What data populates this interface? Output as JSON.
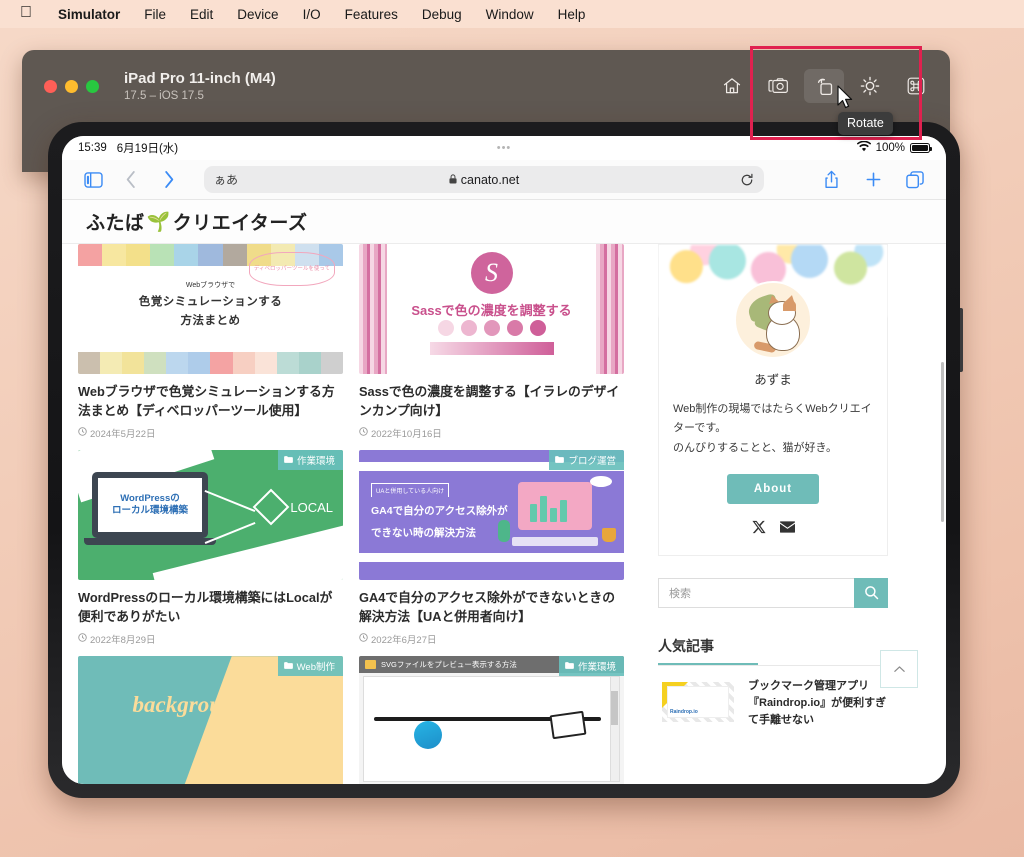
{
  "menubar": {
    "apple_icon": "apple-logo-icon",
    "items": [
      {
        "label": "Simulator",
        "bold": true
      },
      {
        "label": "File",
        "bold": false
      },
      {
        "label": "Edit",
        "bold": false
      },
      {
        "label": "Device",
        "bold": false
      },
      {
        "label": "I/O",
        "bold": false
      },
      {
        "label": "Features",
        "bold": false
      },
      {
        "label": "Debug",
        "bold": false
      },
      {
        "label": "Window",
        "bold": false
      },
      {
        "label": "Help",
        "bold": false
      }
    ]
  },
  "simulator_window": {
    "title": "iPad Pro 11-inch (M4)",
    "subtitle": "17.5 – iOS 17.5",
    "traffic_lights": [
      "close",
      "minimize",
      "zoom"
    ],
    "toolbar": [
      {
        "name": "home-icon",
        "label": "Home"
      },
      {
        "name": "screenshot-icon",
        "label": "Screenshot"
      },
      {
        "name": "rotate-icon",
        "label": "Rotate"
      },
      {
        "name": "brightness-icon",
        "label": "Appearance"
      },
      {
        "name": "command-icon",
        "label": "More"
      }
    ],
    "tooltip": "Rotate",
    "highlight_color": "#e0214f"
  },
  "ipad": {
    "statusbar": {
      "time": "15:39",
      "date": "6月19日(水)",
      "dots": "•••",
      "wifi": "wifi-icon",
      "battery_percent": "100%"
    },
    "safari": {
      "sidebar_icon": "sidebar-icon",
      "back_icon": "chevron-left-icon",
      "forward_icon": "chevron-right-icon",
      "text_size_label": "ぁあ",
      "lock_icon": "lock-icon",
      "url": "canato.net",
      "reload_icon": "reload-icon",
      "share_icon": "share-icon",
      "new_tab_icon": "plus-icon",
      "tabs_icon": "tabs-icon"
    },
    "site": {
      "logo_text_left": "ふたば",
      "logo_emoji": "🌱",
      "logo_text_right": "クリエイターズ",
      "cards": [
        {
          "badge": "",
          "title": "Webブラウザで色覚シミュレーションする方法まとめ【ディベロッパーツール使用】",
          "date": "2024年5月22日",
          "art": "color-vision",
          "art_text_small": "Webブラウザで",
          "art_text_large1": "色覚シミュレーションする",
          "art_text_large2": "方法まとめ",
          "art_bubble": "ディベロッパーツールを使って"
        },
        {
          "badge": "",
          "title": "Sassで色の濃度を調整する【イラレのデザインカンプ向け】",
          "date": "2022年10月16日",
          "art": "sass",
          "art_title": "Sassで色の濃度を調整する"
        },
        {
          "badge": "作業環境",
          "title": "WordPressのローカル環境構築にはLocalが便利でありがたい",
          "date": "2022年8月29日",
          "art": "wordpress-local",
          "art_text1": "WordPressの",
          "art_text2": "ローカル環境構築",
          "art_brand": "LOCAL"
        },
        {
          "badge": "ブログ運営",
          "title": "GA4で自分のアクセス除外ができないときの解決方法【UAと併用者向け】",
          "date": "2022年6月27日",
          "art": "ga4",
          "art_kicker": "UAと併用している人向け",
          "art_line1": "GA4で自分のアクセス除外が",
          "art_line2": "できない時の解決方法"
        },
        {
          "badge": "Web制作",
          "title": "",
          "date": "",
          "art": "background-clip",
          "art_title": "background-clip"
        },
        {
          "badge": "作業環境",
          "title": "",
          "date": "",
          "art": "svg-preview",
          "art_window_title": "SVGファイルをプレビュー表示する方法"
        }
      ],
      "sidebar": {
        "profile_name": "あずま",
        "profile_bio_line1": "Web制作の現場ではたらくWebクリエイターです。",
        "profile_bio_line2": "のんびりすることと、猫が好き。",
        "about_label": "About",
        "social": [
          {
            "name": "x-twitter-icon",
            "glyph": "𝕏"
          },
          {
            "name": "mail-icon",
            "glyph": "✉"
          }
        ],
        "search_placeholder": "検索",
        "search_value": "",
        "search_icon": "search-icon",
        "popular_heading": "人気記事",
        "popular": [
          {
            "title": "ブックマーク管理アプリ『Raindrop.io』が便利すぎて手離せない",
            "thumb_label": "Raindrop.io"
          }
        ],
        "to_top_icon": "chevron-up-icon"
      }
    }
  },
  "colors": {
    "accent_teal": "#6fbcb8",
    "badge_teal": "#68bfbc",
    "highlight_pink": "#e0214f",
    "desktop_bg": "#efc4ad",
    "window_chrome": "#5f5852"
  }
}
